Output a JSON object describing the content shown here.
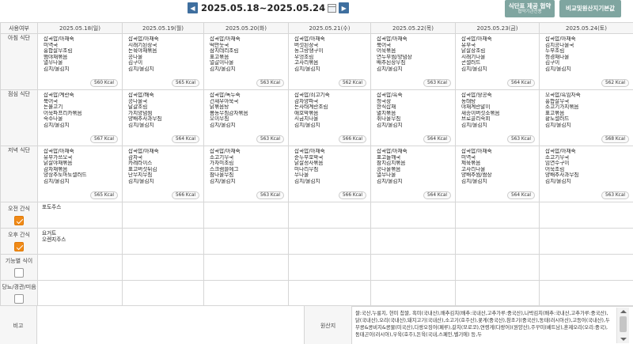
{
  "nav": {
    "prev_icon": "chevron-left-icon",
    "next_icon": "chevron-right-icon",
    "date_range": "2025.05.18~2025.05.24"
  },
  "buttons": {
    "notice_main": "식단표 제공 협약",
    "notice_sub": "협약기관전용",
    "origin": "비교및원산지기본값"
  },
  "header": {
    "corner": "사용여부",
    "days": [
      "2025.05.18(일)",
      "2025.05.19(월)",
      "2025.05.20(화)",
      "2025.05.21(수)",
      "2025.05.22(목)",
      "2025.05.23(금)",
      "2025.05.24(토)"
    ],
    "day_colors": {
      "sunday": "#e14b4b",
      "saturday": "#2f63d8"
    }
  },
  "meals": [
    {
      "label": "아침 식단",
      "days": [
        {
          "items": [
            "잡곡밥/아채죽",
            "미역국",
            "홍합살무조림",
            "햄야채볶음",
            "열무나물",
            "김치/물김치"
          ],
          "kcal": "560 Kcal"
        },
        {
          "items": [
            "잡곡밥/아채죽",
            "시래기된장국",
            "돈육야채볶음",
            "콩나물",
            "김구이",
            "김치/물김치"
          ],
          "kcal": "565 Kcal"
        },
        {
          "items": [
            "잡곡밥/아채죽",
            "떡만둣국",
            "삼치데리조림",
            "표고볶음",
            "얼갈이나물",
            "김치/물김치"
          ],
          "kcal": "563 Kcal"
        },
        {
          "items": [
            "잡곡밥/아채죽",
            "버섯된장국",
            "동그랑땡구이",
            "우엉조림",
            "고사리볶음",
            "김치/물김치"
          ],
          "kcal": "562 Kcal"
        },
        {
          "items": [
            "잡곡밥/아채죽",
            "북어국",
            "어묵볶음",
            "연두부찜/양념장",
            "배추된장무침",
            "김치/물김치"
          ],
          "kcal": "563 Kcal"
        },
        {
          "items": [
            "잡곡밥/아채죽",
            "유부국",
            "닭살장조림",
            "시래기나물",
            "콘샐러드",
            "김치/물김치"
          ],
          "kcal": "564 Kcal"
        },
        {
          "items": [
            "잡곡밥/아채죽",
            "김치콩나물국",
            "두부조림",
            "청경채나물",
            "김구이",
            "김치/물김치"
          ],
          "kcal": "562 Kcal"
        }
      ]
    },
    {
      "label": "점심 식단",
      "days": [
        {
          "items": [
            "잡곡밥/계란죽",
            "북어국",
            "돈불고기",
            "어묵파프리카볶음",
            "숙주나물",
            "김치/물김치"
          ],
          "kcal": "567 Kcal"
        },
        {
          "items": [
            "잡곡밥/해죽",
            "콩나물국",
            "달걀조림",
            "가지양념찜",
            "양배추사과무침",
            "김치/물김치"
          ],
          "kcal": "564 Kcal"
        },
        {
          "items": [
            "잡곡밥/녹두죽",
            "건새우아욱국",
            "닭볶음탕",
            "봄동무침감자볶음",
            "오이무침",
            "김치/물김치"
          ],
          "kcal": "563 Kcal"
        },
        {
          "items": [
            "잡곡밥/쇠고기죽",
            "감자양파국",
            "돈사태계란조림",
            "애호박볶음",
            "시금치나물",
            "김치/물김치"
          ],
          "kcal": "566 Kcal"
        },
        {
          "items": [
            "잡곡밥/흑죽",
            "청국장",
            "한식잡채",
            "멸치볶음",
            "취나물무침",
            "김치/물김치"
          ],
          "kcal": "564 Kcal"
        },
        {
          "items": [
            "잡곡밥/땅콩죽",
            "동태탕",
            "야채계란말이",
            "새송이버섯소볶음",
            "브로콜리숙회",
            "김치/물김치"
          ],
          "kcal": "563 Kcal"
        },
        {
          "items": [
            "오곡밥/흑임자죽",
            "홍합살무국",
            "소고기가지볶음",
            "표고볶음",
            "황도샐러드",
            "김치/물김치"
          ],
          "kcal": "568 Kcal"
        }
      ]
    },
    {
      "label": "저녁 식단",
      "days": [
        {
          "items": [
            "잡곡밥/아채죽",
            "유부가쓰오국",
            "닭살야채볶음",
            "감자채볶음",
            "양상추토마토샐러드",
            "김치/물김치"
          ],
          "kcal": "565 Kcal"
        },
        {
          "items": [
            "잡곡밥/아채죽",
            "감자국",
            "카레라이스",
            "표고버섯튀김",
            "단무지무침",
            "김치/물김치"
          ],
          "kcal": "566 Kcal"
        },
        {
          "items": [
            "잡곡밥/아채죽",
            "소고기무국",
            "가자미조림",
            "스크램블에그",
            "참나물무침",
            "김치/물김치"
          ],
          "kcal": "563 Kcal"
        },
        {
          "items": [
            "잡곡밥/아채죽",
            "순두부호박국",
            "닭살정사볶음",
            "미나리무침",
            "무나물",
            "김치/물김치"
          ],
          "kcal": "566 Kcal"
        },
        {
          "items": [
            "잡곡밥/아채죽",
            "표고들깨국",
            "참치김치볶음",
            "콩나물볶음",
            "열무나물",
            "김치/물김치"
          ],
          "kcal": "564 Kcal"
        },
        {
          "items": [
            "잡곡밥/아채죽",
            "미역국",
            "제육볶음",
            "고사리나물",
            "양배추찜/쌈장",
            "김치/물김치"
          ],
          "kcal": "564 Kcal"
        },
        {
          "items": [
            "잡곡밥/아채죽",
            "소고기무국",
            "임연수구이",
            "어묵조림",
            "양배추사과무침",
            "김치/물김치"
          ],
          "kcal": "563 Kcal"
        }
      ]
    }
  ],
  "snacks": [
    {
      "label": "오전 간식",
      "checked": true,
      "values": [
        "포도주스",
        "",
        "",
        "",
        "",
        "",
        ""
      ]
    },
    {
      "label": "오후 간식",
      "checked": true,
      "values": [
        "요거트\n오렌지주스",
        "",
        "",
        "",
        "",
        "",
        ""
      ]
    },
    {
      "label": "기능별 식이",
      "checked": false,
      "values": [
        "",
        "",
        "",
        "",
        "",
        "",
        ""
      ]
    },
    {
      "label": "당뇨/경관/미음",
      "checked": false,
      "values": [
        "",
        "",
        "",
        "",
        "",
        "",
        ""
      ]
    }
  ],
  "bottom": {
    "remark_label": "비고",
    "origin_label": "원산지",
    "origin_text": "쌀:국산,누룽지, 현미 찹쌀, 흑미(국내산),배추김치(배추:국내산,고추가루:중국산),나박김치(배추:국내산,고추가루:중국산),닭(국내산),오리(국내산),돼지고기(국내산),소고기(호주산),꽃게(중국산),참조기(중국산),동태(러시아산),고등어(국내산),두부콩&콩비지&콩물(미국산),다랑오징어(페루),갈치(모로코),연령게(다랑어)(원양산),주꾸미(베트남),훈제오리(오리:중국),동태곤이(러시아),우육(호주),돈육(국내,스페인,벨기에) 등,두"
  }
}
